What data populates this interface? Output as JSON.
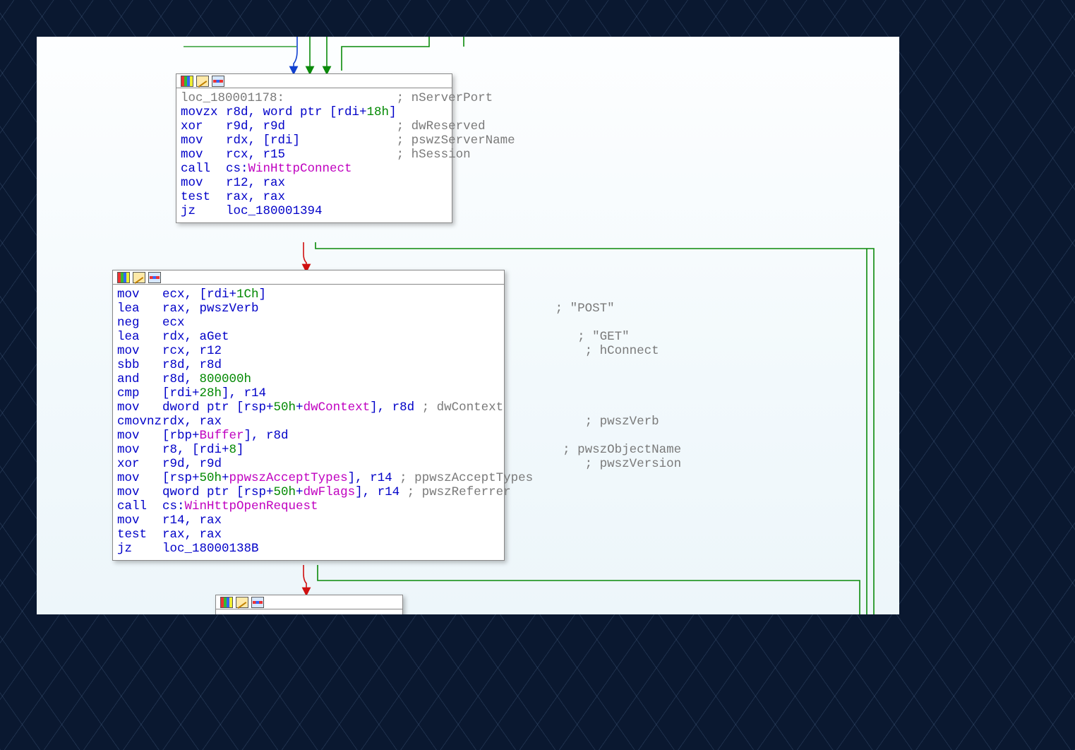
{
  "node1": {
    "mnem0": "loc_180001178:",
    "cmt0": "; nServerPort",
    "r1_m": "movzx",
    "r1_o_a": "r8d",
    "r1_o_b": ", word ptr [rdi+",
    "r1_imm": "18h",
    "r1_o_c": "]",
    "r2_m": "xor",
    "r2_o": "r9d, r9d",
    "r2_c": "; dwReserved",
    "r3_m": "mov",
    "r3_o": "rdx, [rdi]",
    "r3_c": "; pswzServerName",
    "r4_m": "mov",
    "r4_o": "rcx, r15",
    "r4_c": "; hSession",
    "r5_m": "call",
    "r5_pre": "cs:",
    "r5_sym": "WinHttpConnect",
    "r6_m": "mov",
    "r6_o": "r12, rax",
    "r7_m": "test",
    "r7_o": "rax, rax",
    "r8_m": "jz",
    "r8_o": "loc_180001394"
  },
  "node2": {
    "r1_m": "mov",
    "r1_a": "ecx, [rdi+",
    "r1_imm": "1Ch",
    "r1_b": "]",
    "r2_m": "lea",
    "r2_o": "rax, pwszVerb",
    "r2_c": "; \"POST\"",
    "r3_m": "neg",
    "r3_o": "ecx",
    "r4_m": "lea",
    "r4_o": "rdx, aGet",
    "r4_c": "; \"GET\"",
    "r5_m": "mov",
    "r5_o": "rcx, r12",
    "r5_c": "; hConnect",
    "r6_m": "sbb",
    "r6_o": "r8d, r8d",
    "r7_m": "and",
    "r7_a": "r8d, ",
    "r7_imm": "800000h",
    "r8_m": "cmp",
    "r8_a": "[rdi+",
    "r8_imm": "28h",
    "r8_b": "], r14",
    "r9_m": "mov",
    "r9_a": "dword ptr [rsp+",
    "r9_imm": "50h",
    "r9_b": "+",
    "r9_sym": "dwContext",
    "r9_c": "], r8d ",
    "r9_cmt": "; dwContext",
    "r10_m": "cmovnz",
    "r10_o": "rdx, rax",
    "r10_c": "; pwszVerb",
    "r11_m": "mov",
    "r11_a": "[rbp+",
    "r11_sym": "Buffer",
    "r11_b": "], r8d",
    "r12_m": "mov",
    "r12_a": "r8, [rdi+",
    "r12_imm": "8",
    "r12_b": "]",
    "r12_c": "; pwszObjectName",
    "r13_m": "xor",
    "r13_o": "r9d, r9d",
    "r13_c": "; pwszVersion",
    "r14_m": "mov",
    "r14_a": "[rsp+",
    "r14_imm": "50h",
    "r14_b": "+",
    "r14_sym": "ppwszAcceptTypes",
    "r14_c": "], r14 ",
    "r14_cmt": "; ppwszAcceptTypes",
    "r15_m": "mov",
    "r15_a": "qword ptr [rsp+",
    "r15_imm": "50h",
    "r15_b": "+",
    "r15_sym": "dwFlags",
    "r15_c": "], r14 ",
    "r15_cmt": "; pwszReferrer",
    "r16_m": "call",
    "r16_pre": "cs:",
    "r16_sym": "WinHttpOpenRequest",
    "r17_m": "mov",
    "r17_o": "r14, rax",
    "r18_m": "test",
    "r18_o": "rax, rax",
    "r19_m": "jz",
    "r19_o": "loc_18000138B"
  }
}
